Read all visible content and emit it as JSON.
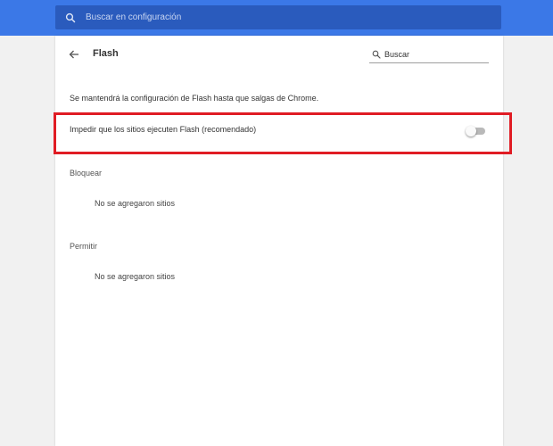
{
  "colors": {
    "topbar": "#3b78e7",
    "topsearch_bg": "#2a5bbd",
    "highlight": "#e01c24",
    "page_bg": "#f1f1f1"
  },
  "top_search": {
    "placeholder": "Buscar en configuración",
    "icon": "search-icon"
  },
  "header": {
    "back_icon": "back-arrow-icon",
    "title": "Flash",
    "search_placeholder": "Buscar",
    "search_icon": "search-icon"
  },
  "info_text": "Se mantendrá la configuración de Flash hasta que salgas de Chrome.",
  "block_flash": {
    "label": "Impedir que los sitios ejecuten Flash (recomendado)",
    "toggle_on": false
  },
  "sections": {
    "block": {
      "title": "Bloquear",
      "empty_text": "No se agregaron sitios"
    },
    "allow": {
      "title": "Permitir",
      "empty_text": "No se agregaron sitios"
    }
  }
}
